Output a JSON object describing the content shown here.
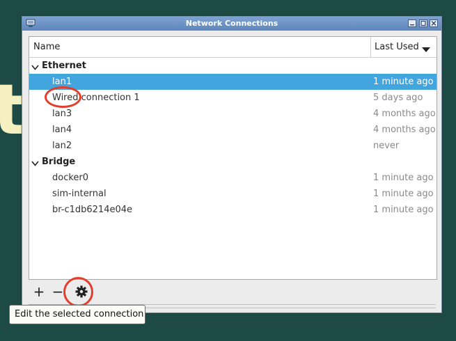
{
  "background": {
    "glyph": "t",
    "color": "#1e4a46",
    "glyph_color": "#f5f0bf"
  },
  "window": {
    "title": "Network Connections",
    "controls": [
      "minimize-icon",
      "maximize-icon",
      "close-icon"
    ]
  },
  "list": {
    "columns": {
      "name": "Name",
      "last_used": "Last Used"
    },
    "sort": "descending",
    "groups": [
      {
        "label": "Ethernet",
        "items": [
          {
            "name": "lan1",
            "last_used": "1 minute ago",
            "selected": true
          },
          {
            "name": "Wired connection 1",
            "last_used": "5 days ago"
          },
          {
            "name": "lan3",
            "last_used": "4 months ago"
          },
          {
            "name": "lan4",
            "last_used": "4 months ago"
          },
          {
            "name": "lan2",
            "last_used": "never"
          }
        ]
      },
      {
        "label": "Bridge",
        "items": [
          {
            "name": "docker0",
            "last_used": "1 minute ago"
          },
          {
            "name": "sim-internal",
            "last_used": "1 minute ago"
          },
          {
            "name": "br-c1db6214e04e",
            "last_used": "1 minute ago"
          }
        ]
      }
    ]
  },
  "toolbar": {
    "add_label": "+",
    "remove_label": "−",
    "settings_icon": "gear-icon"
  },
  "tooltip": {
    "text": "Edit the selected connection"
  },
  "colors": {
    "selection": "#43a5dd",
    "annotation_ring": "#e53d2b",
    "titlebar": "#6f95c8"
  }
}
